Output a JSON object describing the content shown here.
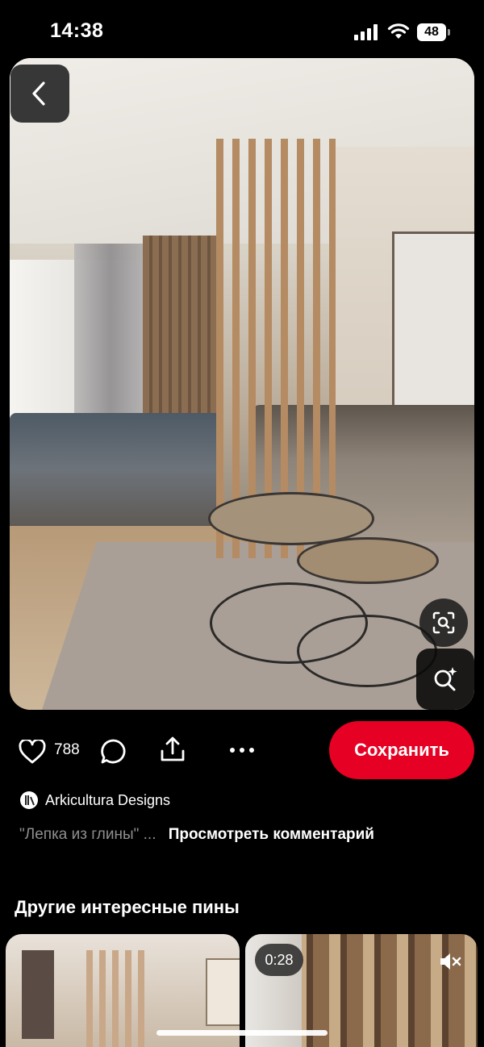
{
  "status_bar": {
    "time": "14:38",
    "battery_level": "48",
    "icons": [
      "cellular-signal-icon",
      "wifi-icon",
      "battery-icon"
    ]
  },
  "pin": {
    "image_description_icon": "interior-photo",
    "back_icon": "chevron-left-icon",
    "visual_search_icon": "lens-search-icon",
    "shuffle_icon": "magic-search-icon"
  },
  "actions": {
    "like_icon": "heart-icon",
    "like_count": "788",
    "comment_icon": "comment-bubble-icon",
    "share_icon": "share-icon",
    "more_icon": "more-dots-icon",
    "save_label": "Сохранить"
  },
  "author": {
    "name": "Arkicultura Designs"
  },
  "comments": {
    "preview": "\"Лепка из глины\" ...",
    "view_label": "Просмотреть комментарий"
  },
  "more_pins": {
    "title": "Другие интересные пины",
    "items": [
      {
        "type": "image"
      },
      {
        "type": "video",
        "duration": "0:28",
        "mute_icon": "speaker-muted-icon"
      }
    ]
  },
  "colors": {
    "background": "#000000",
    "save_button": "#e60023",
    "muted_text": "#8e8e8e"
  }
}
